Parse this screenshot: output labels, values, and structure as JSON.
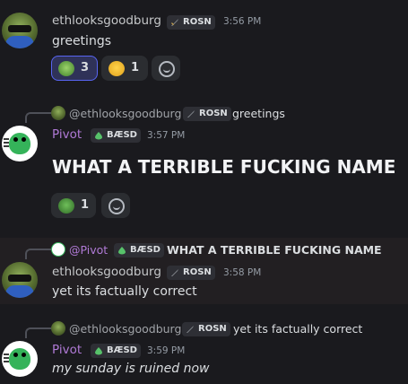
{
  "messages": [
    {
      "author": "ethlooksgoodburg",
      "tag": "ROSN",
      "time": "3:56 PM",
      "text": "greetings",
      "reactions": [
        {
          "emoji": "frog-emoji",
          "count": "3",
          "active": true
        },
        {
          "emoji": "laughing-emoji",
          "count": "1",
          "active": false
        }
      ]
    },
    {
      "reply": {
        "author": "@ethlooksgoodburg",
        "tag": "ROSN",
        "text": "greetings"
      },
      "author": "Pivot",
      "tag": "BÆSD",
      "time": "3:57 PM",
      "text": "WHAT A TERRIBLE FUCKING NAME",
      "reactions": [
        {
          "emoji": "pepe-emoji",
          "count": "1",
          "active": false
        }
      ]
    },
    {
      "reply": {
        "author": "@Pivot",
        "tag": "BÆSD",
        "text": "WHAT A TERRIBLE FUCKING NAME"
      },
      "author": "ethlooksgoodburg",
      "tag": "ROSN",
      "time": "3:58 PM",
      "text": "yet its factually correct"
    },
    {
      "reply": {
        "author": "@ethlooksgoodburg",
        "tag": "ROSN",
        "text": "yet its factually correct"
      },
      "author": "Pivot",
      "tag": "BÆSD",
      "time": "3:59 PM",
      "text": "my sunday is ruined now"
    }
  ],
  "colors": {
    "background": "#1a1a1e",
    "pivot_name": "#b07ad6",
    "eth_name": "#c5c7c9",
    "reaction_active_border": "#5865f2"
  }
}
